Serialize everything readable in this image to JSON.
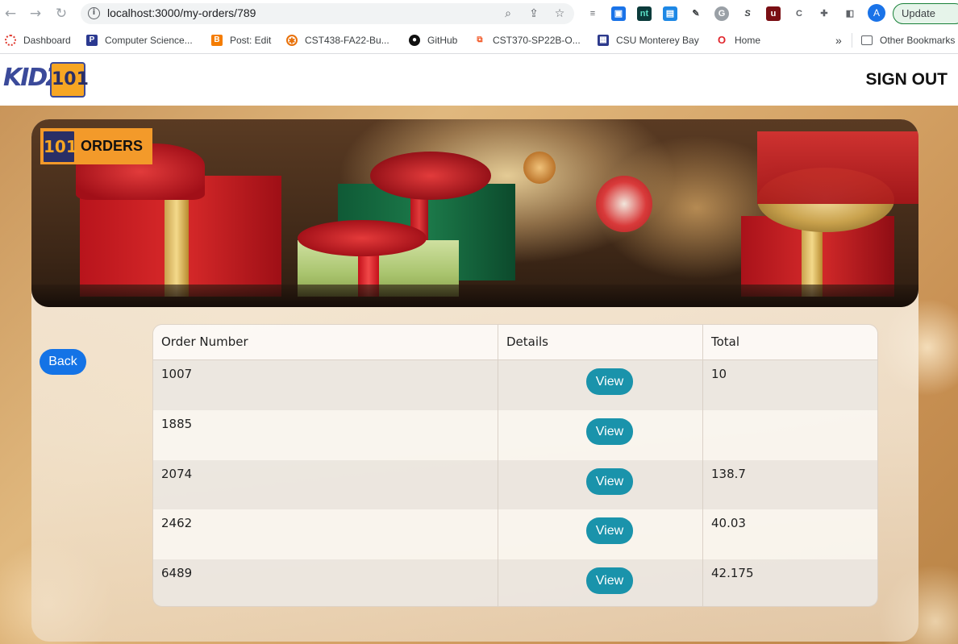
{
  "browser": {
    "url": "localhost:3000/my-orders/789",
    "update_label": "Update",
    "profile_initial": "A",
    "bookmarks": [
      {
        "label": "Dashboard",
        "icon": "canvas-icon",
        "color": "#e03c31"
      },
      {
        "label": "Computer Science...",
        "icon": "p-icon",
        "color": "#2b3990"
      },
      {
        "label": "Post: Edit",
        "icon": "blogger-icon",
        "color": "#f57d00"
      },
      {
        "label": "CST438-FA22-Bu...",
        "icon": "gear-icon",
        "color": "#e8710a"
      },
      {
        "label": "GitHub",
        "icon": "github-icon",
        "color": "#111111"
      },
      {
        "label": "CST370-SP22B-O...",
        "icon": "puzzle-icon",
        "color": "#f25a29"
      },
      {
        "label": "CSU Monterey Bay",
        "icon": "csumb-icon",
        "color": "#2d3a8c"
      },
      {
        "label": "Home",
        "icon": "o-icon",
        "color": "#e0242b"
      }
    ],
    "overflow_label": "»",
    "other_bookmarks_label": "Other Bookmarks"
  },
  "app": {
    "logo_text": "KIDZ",
    "logo_number": "101",
    "sign_out_label": "SIGN OUT"
  },
  "page": {
    "title": "ORDERS",
    "badge_icon_text": "101",
    "back_label": "Back"
  },
  "table": {
    "headers": [
      "Order Number",
      "Details",
      "Total"
    ],
    "view_label": "View",
    "rows": [
      {
        "order_number": "1007",
        "total": "10"
      },
      {
        "order_number": "1885",
        "total": ""
      },
      {
        "order_number": "2074",
        "total": "138.7"
      },
      {
        "order_number": "2462",
        "total": "40.03"
      },
      {
        "order_number": "6489",
        "total": "42.175"
      }
    ]
  },
  "colors": {
    "back_button": "#1473e6",
    "view_button": "#1a93ab",
    "badge": "#f39a2a"
  }
}
